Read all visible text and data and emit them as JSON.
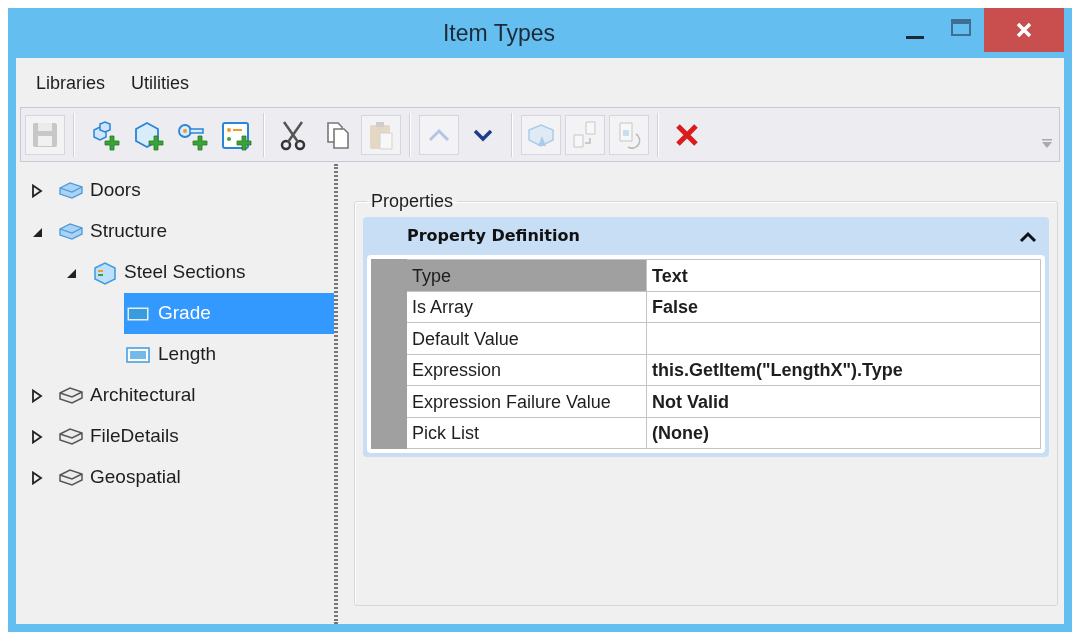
{
  "window": {
    "title": "Item Types"
  },
  "menu": [
    {
      "label": "Libraries"
    },
    {
      "label": "Utilities"
    }
  ],
  "toolbar": [
    [
      {
        "disabled": true
      }
    ],
    [
      {
        "disabled": false
      },
      {
        "disabled": false
      },
      {
        "disabled": false
      },
      {
        "disabled": false
      }
    ],
    [
      {
        "disabled": false
      },
      {
        "disabled": false
      },
      {
        "disabled": true
      }
    ],
    [
      {
        "disabled": true
      },
      {
        "disabled": false
      }
    ],
    [
      {
        "disabled": true
      },
      {
        "disabled": true
      },
      {
        "disabled": true
      }
    ],
    [
      {
        "disabled": false
      }
    ]
  ],
  "tree": [
    {
      "label": "Doors",
      "kind": "library",
      "expanded": false,
      "selected": false
    },
    {
      "label": "Structure",
      "kind": "library",
      "expanded": true,
      "selected": false,
      "children": [
        {
          "label": "Steel Sections",
          "kind": "item-type",
          "expanded": true,
          "selected": false,
          "children": [
            {
              "label": "Grade",
              "kind": "text-property",
              "selected": true
            },
            {
              "label": "Length",
              "kind": "number-property",
              "selected": false
            }
          ]
        }
      ]
    },
    {
      "label": "Architectural",
      "kind": "external-library",
      "expanded": false,
      "selected": false
    },
    {
      "label": "FileDetails",
      "kind": "external-library",
      "expanded": false,
      "selected": false
    },
    {
      "label": "Geospatial",
      "kind": "external-library",
      "expanded": false,
      "selected": false
    }
  ],
  "properties": {
    "title": "Properties",
    "section": {
      "title": "Property Definition",
      "expanded": true,
      "rows": [
        {
          "label": "Type",
          "value": "Text",
          "selected": true
        },
        {
          "label": "Is Array",
          "value": "False",
          "selected": false
        },
        {
          "label": "Default Value",
          "selected": false
        },
        {
          "label": "Expression",
          "value": "this.GetItem(\"LengthX\").Type",
          "selected": false
        },
        {
          "label": "Expression Failure Value",
          "value": "Not Valid",
          "selected": false
        },
        {
          "label": "Pick List",
          "value": "(None)",
          "selected": false
        }
      ]
    }
  }
}
